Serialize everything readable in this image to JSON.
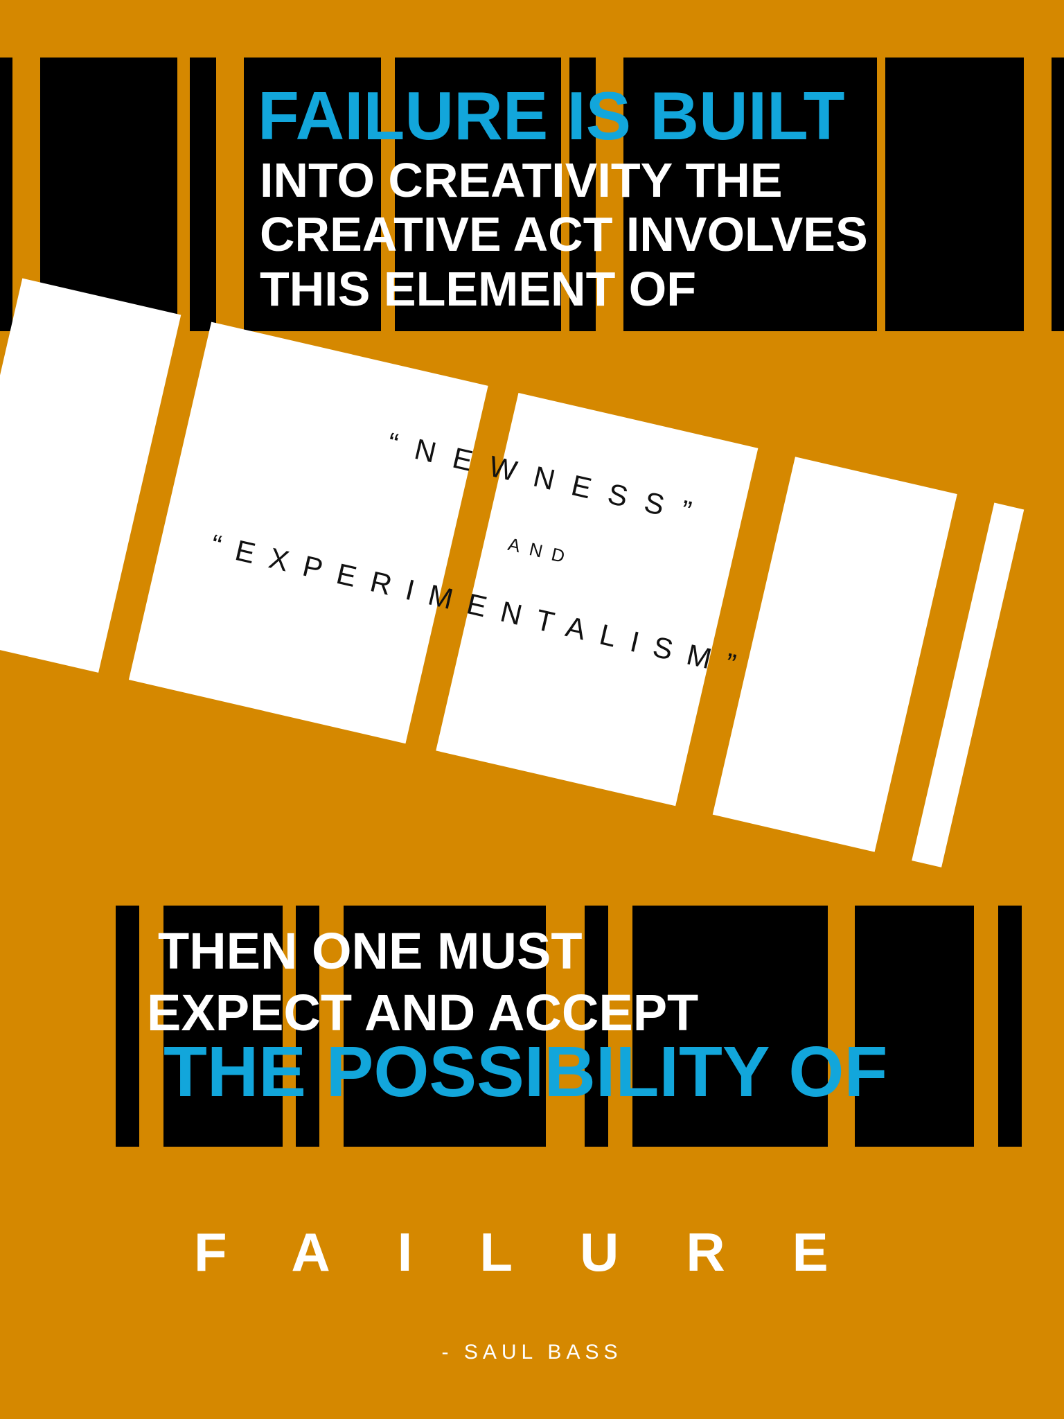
{
  "poster": {
    "headline_top": "FAILURE IS BUILT",
    "intro_lines": [
      "INTO CREATIVITY THE",
      "CREATIVE ACT INVOLVES",
      "THIS ELEMENT OF"
    ],
    "quote": {
      "word_1": "“NEWNESS”",
      "conjunction": "AND",
      "word_2": "“EXPERIMENTALISM”"
    },
    "outro_lines": [
      "THEN ONE MUST",
      "EXPECT AND ACCEPT"
    ],
    "headline_bottom": "THE POSSIBILITY OF",
    "final_word": "FAILURE",
    "attribution": "- SAUL BASS"
  },
  "colors": {
    "background": "#d58800",
    "bars": "#000000",
    "accent": "#12a6db",
    "text": "#ffffff"
  }
}
